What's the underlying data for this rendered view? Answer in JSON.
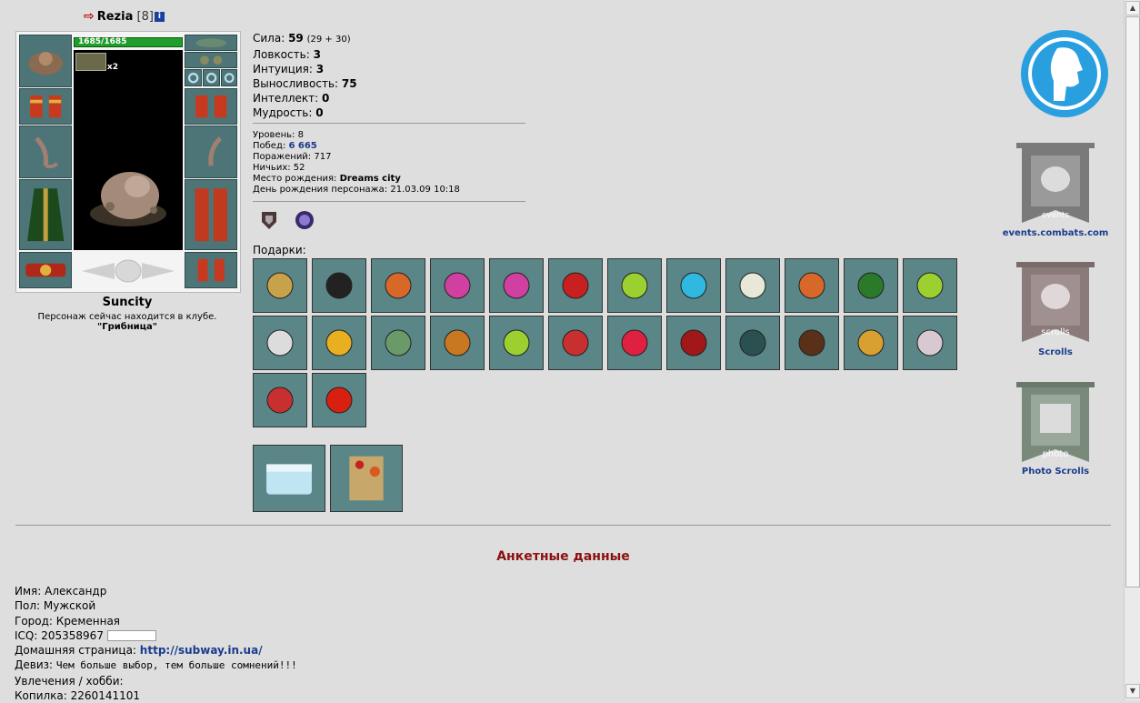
{
  "header": {
    "name": "Rezia",
    "level": "[8]",
    "info_icon": "i"
  },
  "doll": {
    "hp": "1685/1685",
    "multiplier": "x2",
    "city": "Suncity",
    "location_text": "Персонаж сейчас находится в клубе.",
    "location_name": "\"Грибница\""
  },
  "stats": [
    {
      "label": "Сила:",
      "value": "59",
      "sub": "(29 + 30)"
    },
    {
      "label": "Ловкость:",
      "value": "3",
      "sub": ""
    },
    {
      "label": "Интуиция:",
      "value": "3",
      "sub": ""
    },
    {
      "label": "Выносливость:",
      "value": "75",
      "sub": ""
    },
    {
      "label": "Интеллект:",
      "value": "0",
      "sub": ""
    },
    {
      "label": "Мудрость:",
      "value": "0",
      "sub": ""
    }
  ],
  "info": {
    "level_label": "Уровень:",
    "level": "8",
    "wins_label": "Побед:",
    "wins": "6 665",
    "losses_label": "Поражений:",
    "losses": "717",
    "draws_label": "Ничьих:",
    "draws": "52",
    "birthplace_label": "Место рождения:",
    "birthplace": "Dreams city",
    "birthday_label": "День рождения персонажа:",
    "birthday": "21.03.09 10:18"
  },
  "gifts_label": "Подарки:",
  "gifts": [
    {
      "icon": "shield-badge-icon",
      "color": "#c8a24a"
    },
    {
      "icon": "mace-icon",
      "color": "#222222"
    },
    {
      "icon": "amber-stone-icon",
      "color": "#d8682a"
    },
    {
      "icon": "pink-flower-icon",
      "color": "#d040a0"
    },
    {
      "icon": "pink-flower-icon",
      "color": "#d040a0"
    },
    {
      "icon": "red-banner-icon",
      "color": "#c82020"
    },
    {
      "icon": "green-gem-icon",
      "color": "#9cd030"
    },
    {
      "icon": "blue-mushroom-icon",
      "color": "#30b8e0"
    },
    {
      "icon": "white-plate-icon",
      "color": "#e8e8d8"
    },
    {
      "icon": "amber-stone-icon",
      "color": "#d8682a"
    },
    {
      "icon": "green-book-icon",
      "color": "#2a7a2a"
    },
    {
      "icon": "green-gem-icon",
      "color": "#9cd030"
    },
    {
      "icon": "snowflake-icon",
      "color": "#dcdcdc"
    },
    {
      "icon": "golden-bell-icon",
      "color": "#e8b020"
    },
    {
      "icon": "green-cabbage-icon",
      "color": "#6a9a6a"
    },
    {
      "icon": "winter-card-icon",
      "color": "#c87820"
    },
    {
      "icon": "green-gem-icon",
      "color": "#9cd030"
    },
    {
      "icon": "red-rose-fist-icon",
      "color": "#c83030"
    },
    {
      "icon": "heart-frame-icon",
      "color": "#e02040"
    },
    {
      "icon": "red-heart-icon",
      "color": "#a01818"
    },
    {
      "icon": "teal-book-icon",
      "color": "#2a5050"
    },
    {
      "icon": "brown-book-icon",
      "color": "#5a3018"
    },
    {
      "icon": "gold-emblem-icon",
      "color": "#d8a030"
    },
    {
      "icon": "pink-crest-icon",
      "color": "#d8c8d0"
    },
    {
      "icon": "red-rose-fist-icon",
      "color": "#c83030"
    },
    {
      "icon": "red-card-icon",
      "color": "#d82010"
    }
  ],
  "big_gifts": [
    {
      "icon": "ice-chest-icon",
      "color": "#b8e0f0"
    },
    {
      "icon": "greeting-card-icon",
      "color": "#c8a860"
    }
  ],
  "right": {
    "banner1_label": "events.combats.com",
    "banner1_text": "events",
    "banner2_label": "Scrolls",
    "banner2_text": "scrolls",
    "banner3_label": "Photo Scrolls",
    "banner3_text": "photo"
  },
  "profile": {
    "title": "Анкетные данные",
    "name_label": "Имя:",
    "name": "Александр",
    "sex_label": "Пол:",
    "sex": "Мужской",
    "city_label": "Город:",
    "city": "Кременная",
    "icq_label": "ICQ:",
    "icq": "205358967",
    "homepage_label": "Домашняя страница:",
    "homepage": "http://subway.in.ua/",
    "motto_label": "Девиз:",
    "motto": "Чем больше выбор, тем больше сомнений!!!",
    "hobby_label": "Увлечения / хобби:",
    "piggy_label": "Копилка:",
    "piggy": "2260141101"
  }
}
